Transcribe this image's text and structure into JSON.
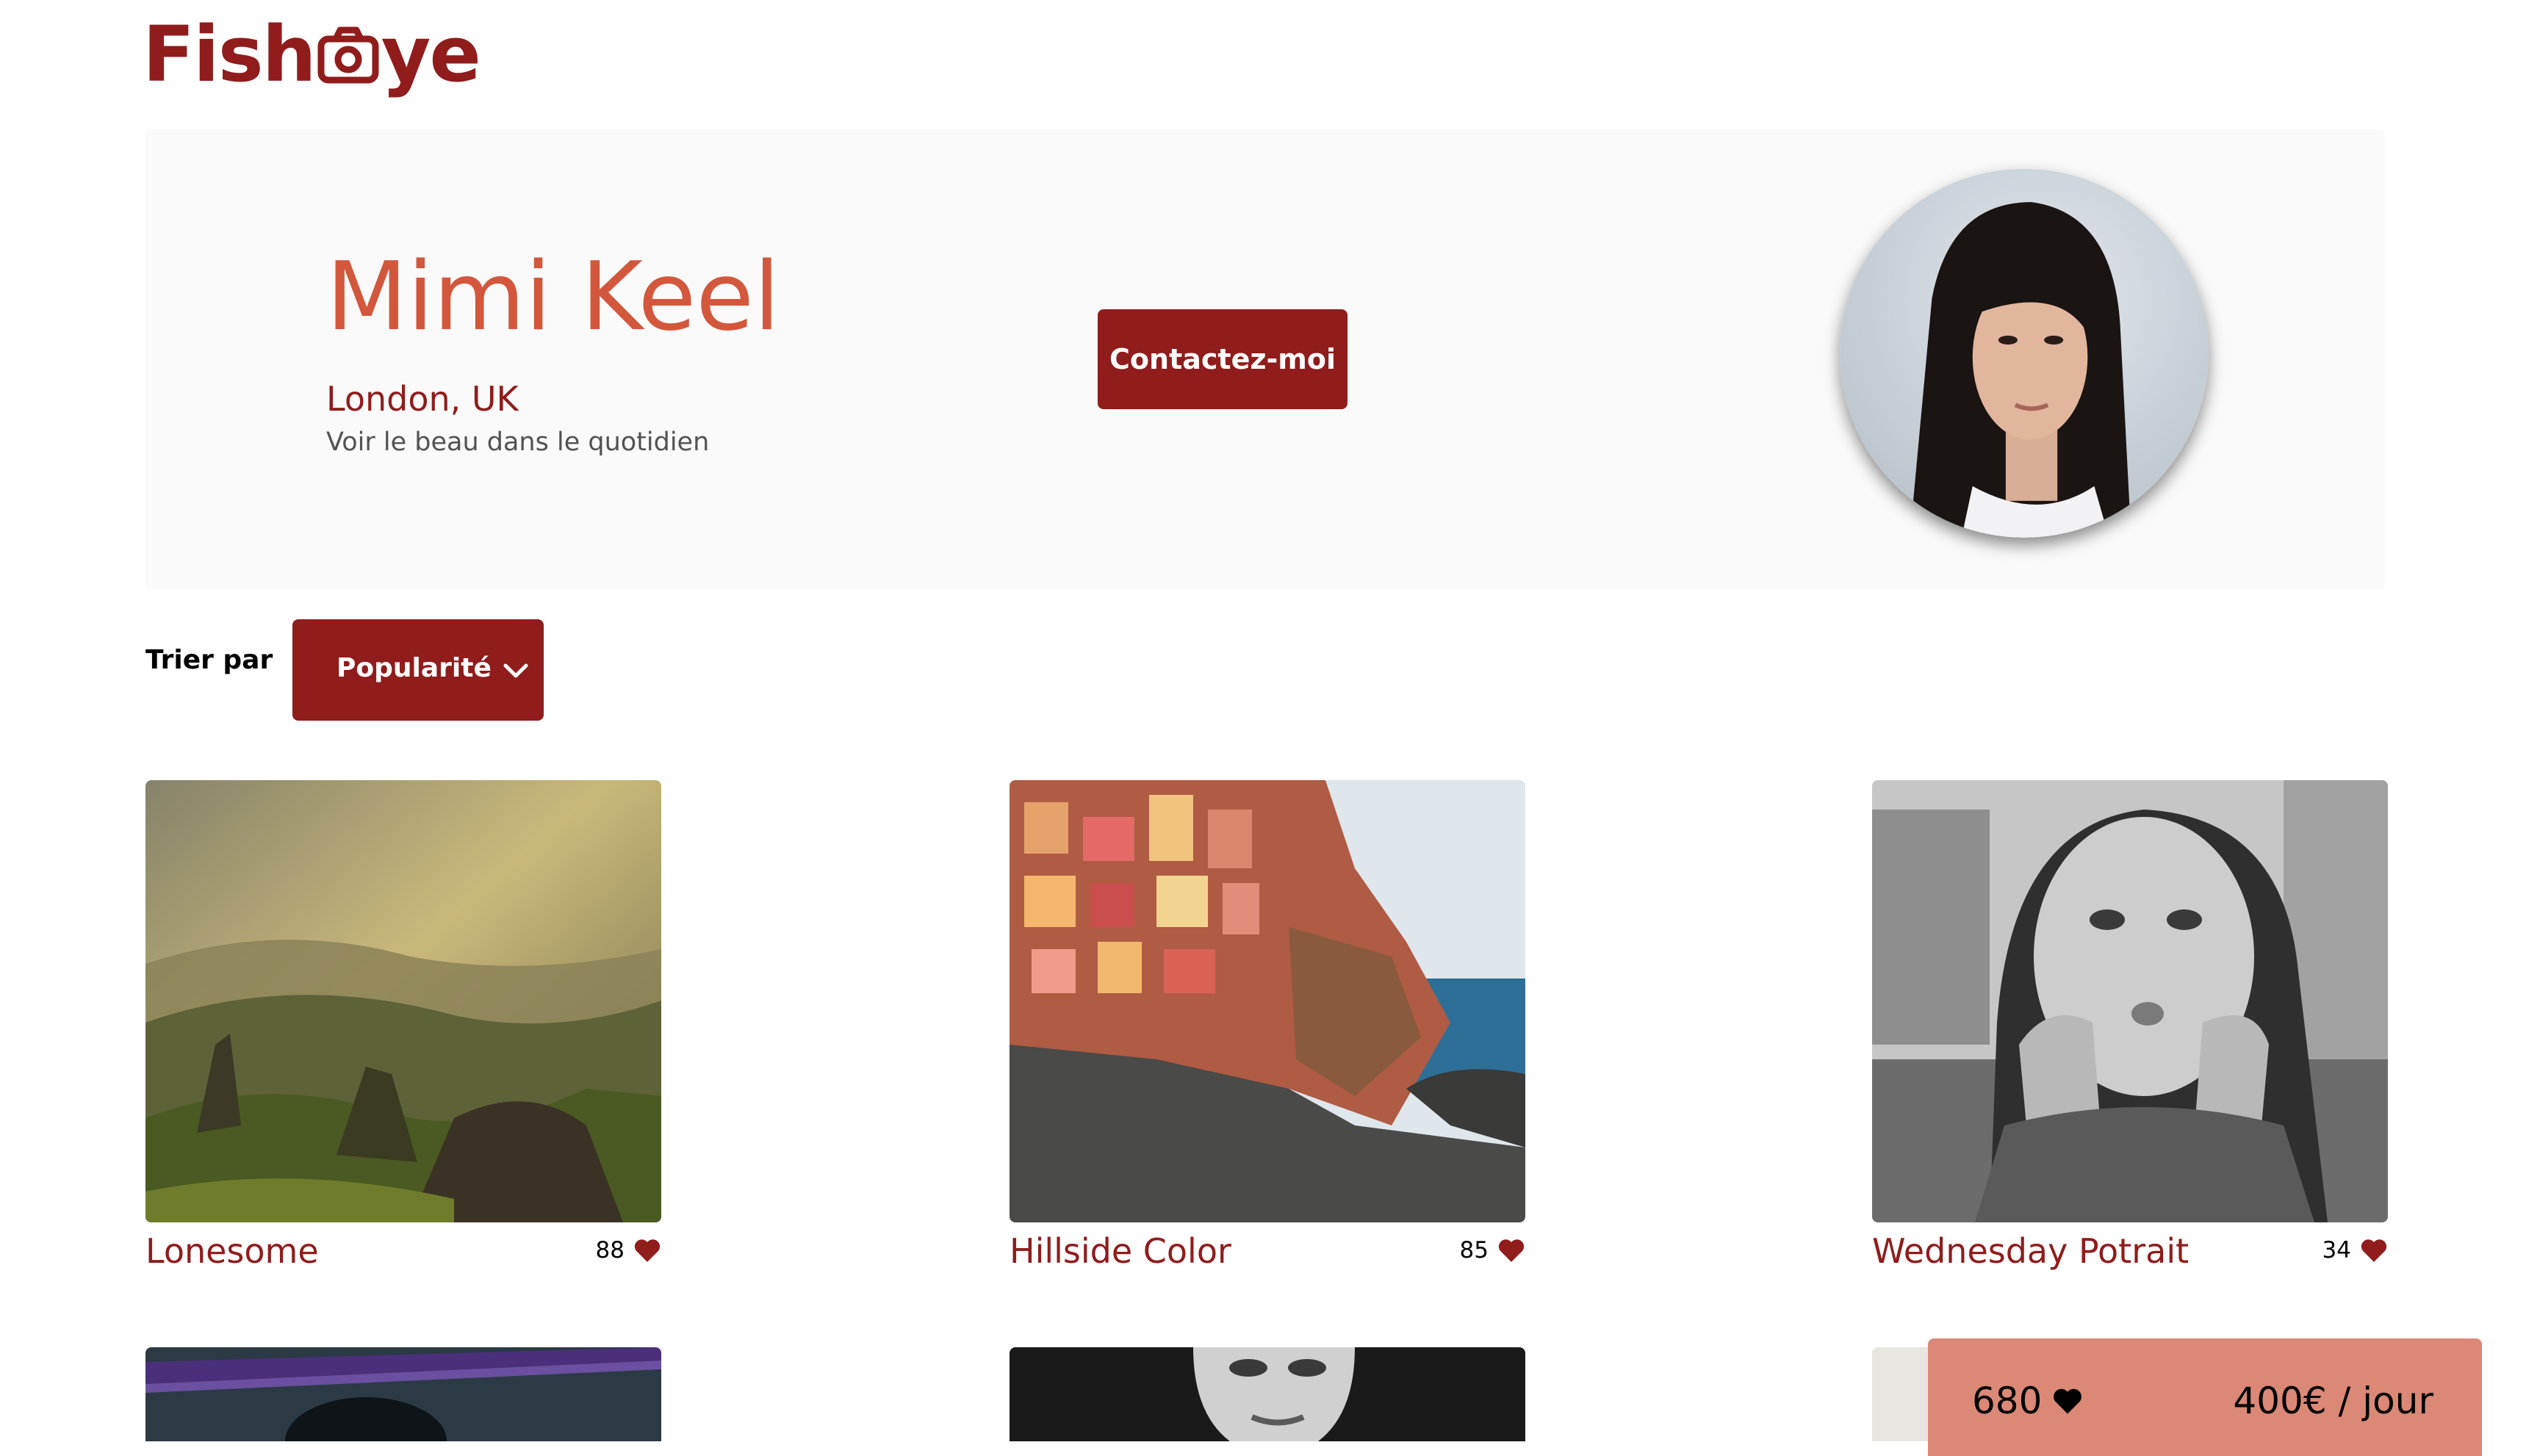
{
  "logo": {
    "left": "Fish",
    "right": "ye"
  },
  "profile": {
    "name": "Mimi Keel",
    "location": "London, UK",
    "tagline": "Voir le beau dans le quotidien",
    "contact_label": "Contactez-moi"
  },
  "sort": {
    "label": "Trier par",
    "selected": "Popularité"
  },
  "media": [
    {
      "title": "Lonesome",
      "likes": "88"
    },
    {
      "title": "Hillside Color",
      "likes": "85"
    },
    {
      "title": "Wednesday Potrait",
      "likes": "34"
    }
  ],
  "summary": {
    "total_likes": "680",
    "price": "400€ / jour"
  },
  "colors": {
    "primary": "#901C1C",
    "secondary": "#D3573C",
    "summary_bg": "#DB8876",
    "card_bg": "#FAFAFA"
  }
}
